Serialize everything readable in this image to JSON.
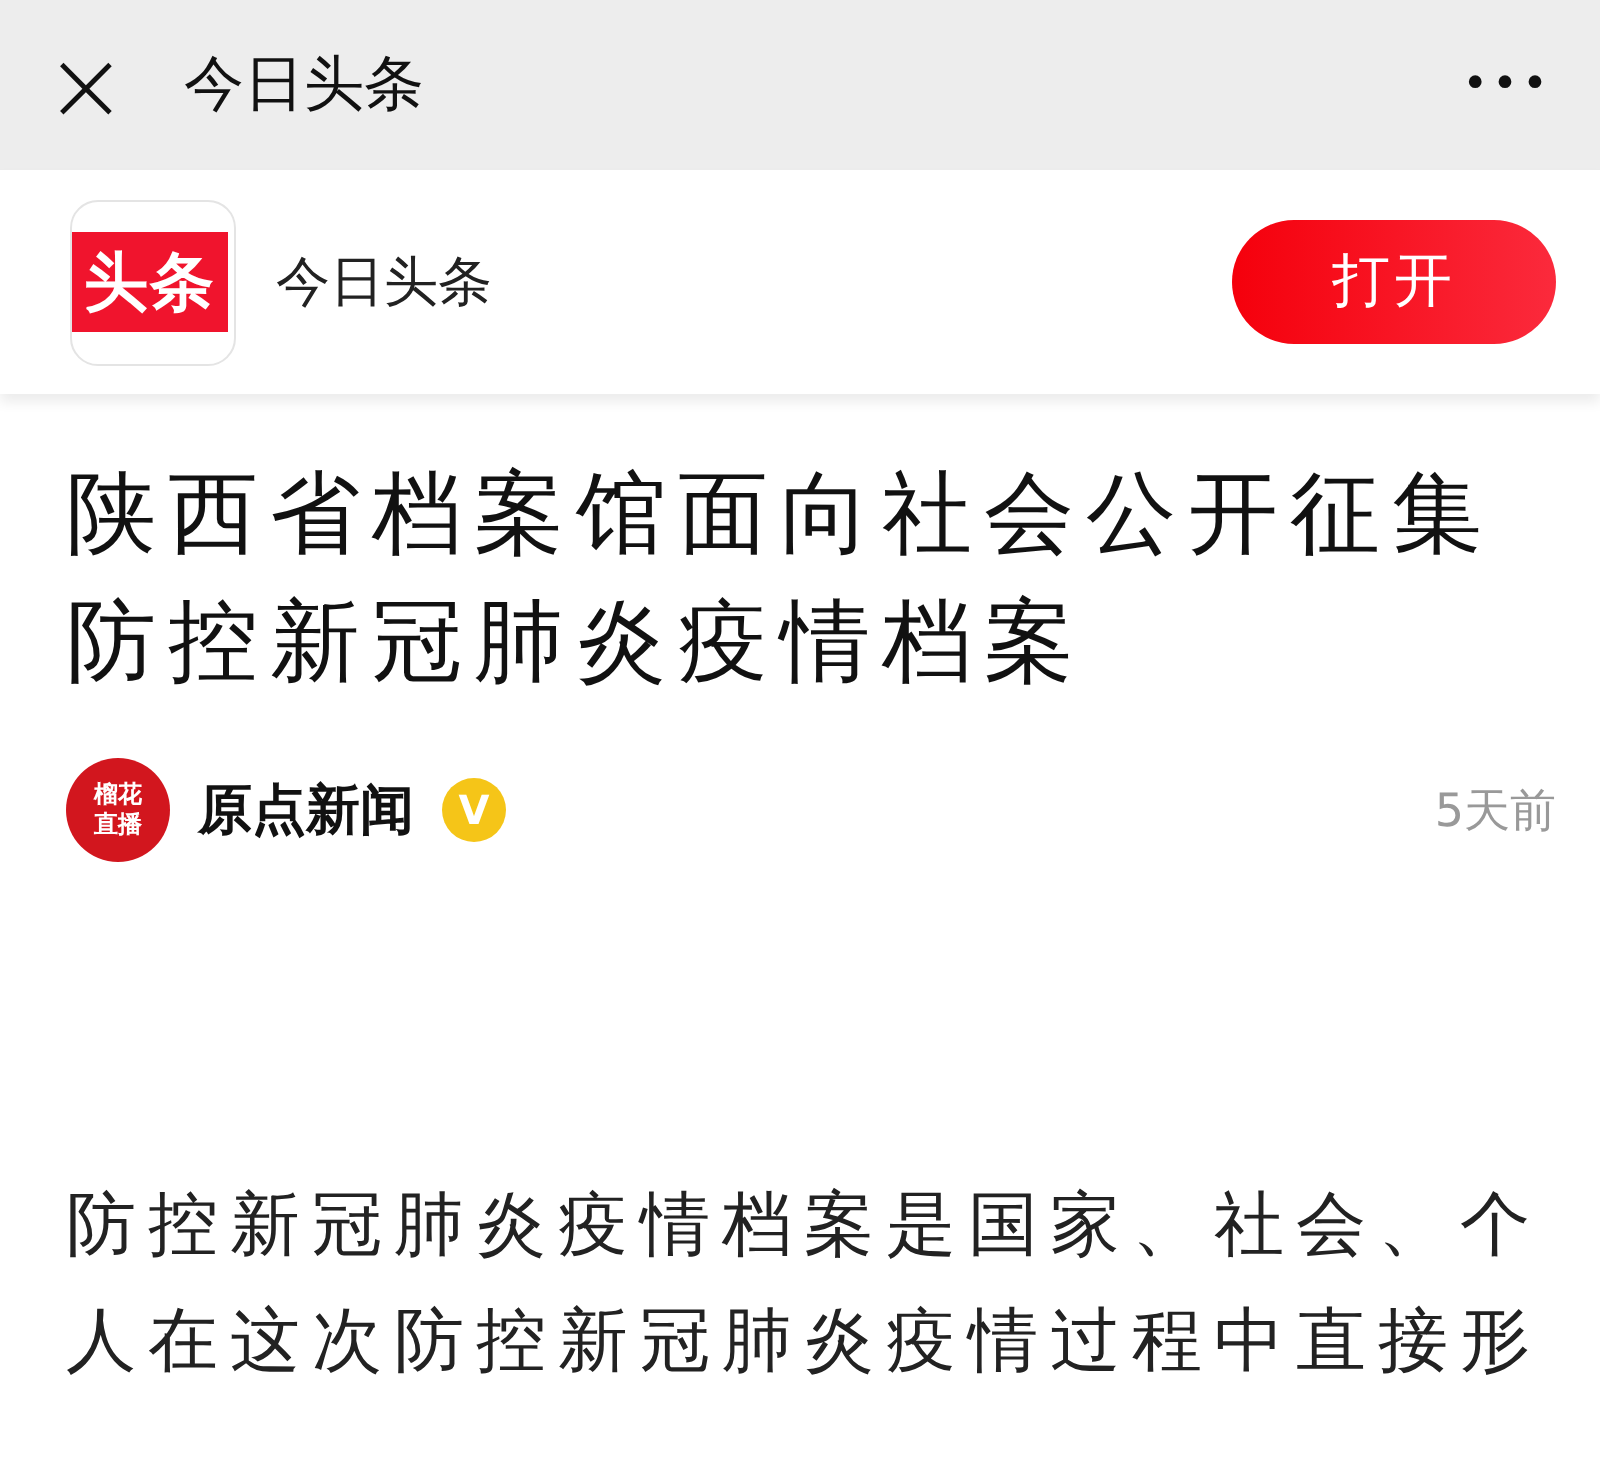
{
  "top_bar": {
    "close": "×",
    "title": "今日头条",
    "more": "•••"
  },
  "app_banner": {
    "logo_text": "头条",
    "app_name": "今日头条",
    "open_button": "打开"
  },
  "article": {
    "title": "陕西省档案馆面向社会公开征集防控新冠肺炎疫情档案",
    "author": {
      "avatar_text": "榴花直播",
      "name": "原点新闻",
      "verified": true,
      "verified_badge": "V",
      "time": "5天前"
    },
    "body": "防控新冠肺炎疫情档案是国家、社会、个人在这次防控新冠肺炎疫情过程中直接形"
  }
}
